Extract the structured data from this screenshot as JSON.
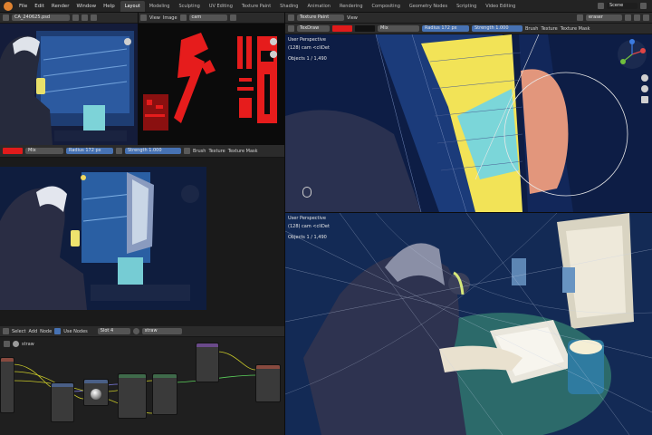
{
  "menu": {
    "items": [
      "File",
      "Edit",
      "Render",
      "Window",
      "Help"
    ]
  },
  "workspace_tabs": [
    "Layout",
    "Modeling",
    "Sculpting",
    "UV Editing",
    "Texture Paint",
    "Shading",
    "Animation",
    "Rendering",
    "Compositing",
    "Geometry Nodes",
    "Scripting",
    "Video Editing"
  ],
  "active_tab": "Layout",
  "scene": {
    "name": "Scene"
  },
  "top_left_view": {
    "file_name": "CA_240625.psd",
    "view_label": "View",
    "image_label": "Image",
    "image_name": "cam"
  },
  "paint_toolbar": {
    "blend": "Mix",
    "radius_label": "Radius",
    "radius_value": "172 px",
    "strength_label": "Strength",
    "strength_value": "1.000",
    "brush_label": "Brush",
    "texture_label": "Texture",
    "texture_mask_label": "Texture Mask",
    "primary_color": "#e01b1b"
  },
  "right_header": {
    "mode": "Texture Paint",
    "view_label": "View",
    "tool": "TexDraw",
    "material": "eraser",
    "object": "Scene"
  },
  "viewport_top": {
    "perspective": "User Perspective",
    "collection": "(128) cam <cliDet",
    "objects": "Objects    1 / 1,490"
  },
  "viewport_bottom": {
    "perspective": "User Perspective",
    "collection": "(128) cam <cliDet",
    "objects": "Objects    1 / 1,490"
  },
  "node_editor": {
    "menus": [
      "Select",
      "Add",
      "Node"
    ],
    "use_nodes_label": "Use Nodes",
    "slot": "Slot 4",
    "material": "straw",
    "material_name": "straw"
  },
  "colors": {
    "accent": "#4772b3",
    "active_orange": "#e08330",
    "header": "#2b2b2b",
    "background": "#1d1d1d"
  }
}
